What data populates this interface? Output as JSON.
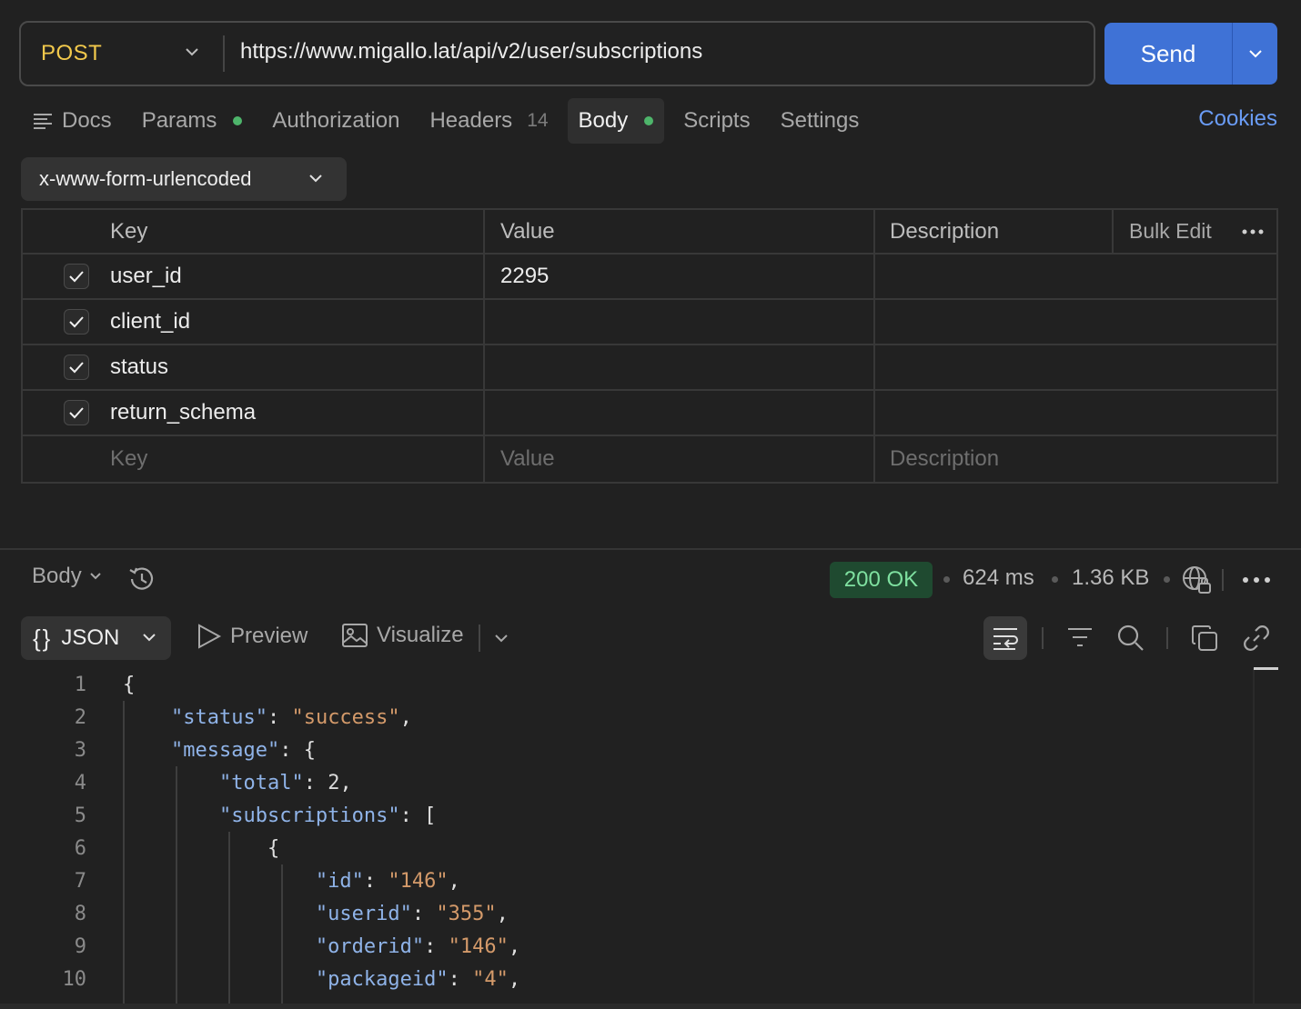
{
  "request": {
    "method": "POST",
    "url": "https://www.migallo.lat/api/v2/user/subscriptions",
    "send_label": "Send"
  },
  "tabs": [
    {
      "label": "Docs",
      "icon": "docs-icon"
    },
    {
      "label": "Params",
      "dot": true
    },
    {
      "label": "Authorization"
    },
    {
      "label": "Headers",
      "count": "14"
    },
    {
      "label": "Body",
      "dot": true,
      "active": true
    },
    {
      "label": "Scripts"
    },
    {
      "label": "Settings"
    }
  ],
  "cookies_label": "Cookies",
  "body_type": "x-www-form-urlencoded",
  "table": {
    "headers": {
      "key": "Key",
      "value": "Value",
      "description": "Description",
      "bulk_edit": "Bulk Edit"
    },
    "rows": [
      {
        "key": "user_id",
        "value": "2295",
        "description": "",
        "checked": true
      },
      {
        "key": "client_id",
        "value": "",
        "description": "",
        "checked": true
      },
      {
        "key": "status",
        "value": "",
        "description": "",
        "checked": true
      },
      {
        "key": "return_schema",
        "value": "",
        "description": "",
        "checked": true
      }
    ],
    "placeholders": {
      "key": "Key",
      "value": "Value",
      "description": "Description"
    }
  },
  "response": {
    "body_tab": "Body",
    "status": "200 OK",
    "time": "624 ms",
    "size": "1.36 KB",
    "format": "JSON",
    "preview_label": "Preview",
    "visualize_label": "Visualize"
  },
  "colors": {
    "accent": "#3f72d6",
    "method": "#f2c94c",
    "status_ok_bg": "#1f4a30",
    "status_ok_fg": "#7fe0a0",
    "dot": "#4eb56b",
    "json_key": "#8fb3e8",
    "json_string": "#d49a6a",
    "link": "#6a9cf5"
  },
  "code_lines": [
    {
      "n": "1",
      "depth": 0,
      "tokens": [
        [
          "p",
          "{"
        ]
      ]
    },
    {
      "n": "2",
      "depth": 1,
      "tokens": [
        [
          "k",
          "\"status\""
        ],
        [
          "p",
          ": "
        ],
        [
          "s",
          "\"success\""
        ],
        [
          "p",
          ","
        ]
      ]
    },
    {
      "n": "3",
      "depth": 1,
      "tokens": [
        [
          "k",
          "\"message\""
        ],
        [
          "p",
          ": {"
        ]
      ]
    },
    {
      "n": "4",
      "depth": 2,
      "tokens": [
        [
          "k",
          "\"total\""
        ],
        [
          "p",
          ": "
        ],
        [
          "n",
          "2"
        ],
        [
          "p",
          ","
        ]
      ]
    },
    {
      "n": "5",
      "depth": 2,
      "tokens": [
        [
          "k",
          "\"subscriptions\""
        ],
        [
          "p",
          ": ["
        ]
      ]
    },
    {
      "n": "6",
      "depth": 3,
      "tokens": [
        [
          "p",
          "{"
        ]
      ]
    },
    {
      "n": "7",
      "depth": 4,
      "tokens": [
        [
          "k",
          "\"id\""
        ],
        [
          "p",
          ": "
        ],
        [
          "s",
          "\"146\""
        ],
        [
          "p",
          ","
        ]
      ]
    },
    {
      "n": "8",
      "depth": 4,
      "tokens": [
        [
          "k",
          "\"userid\""
        ],
        [
          "p",
          ": "
        ],
        [
          "s",
          "\"355\""
        ],
        [
          "p",
          ","
        ]
      ]
    },
    {
      "n": "9",
      "depth": 4,
      "tokens": [
        [
          "k",
          "\"orderid\""
        ],
        [
          "p",
          ": "
        ],
        [
          "s",
          "\"146\""
        ],
        [
          "p",
          ","
        ]
      ]
    },
    {
      "n": "10",
      "depth": 4,
      "tokens": [
        [
          "k",
          "\"packageid\""
        ],
        [
          "p",
          ": "
        ],
        [
          "s",
          "\"4\""
        ],
        [
          "p",
          ","
        ]
      ]
    }
  ]
}
